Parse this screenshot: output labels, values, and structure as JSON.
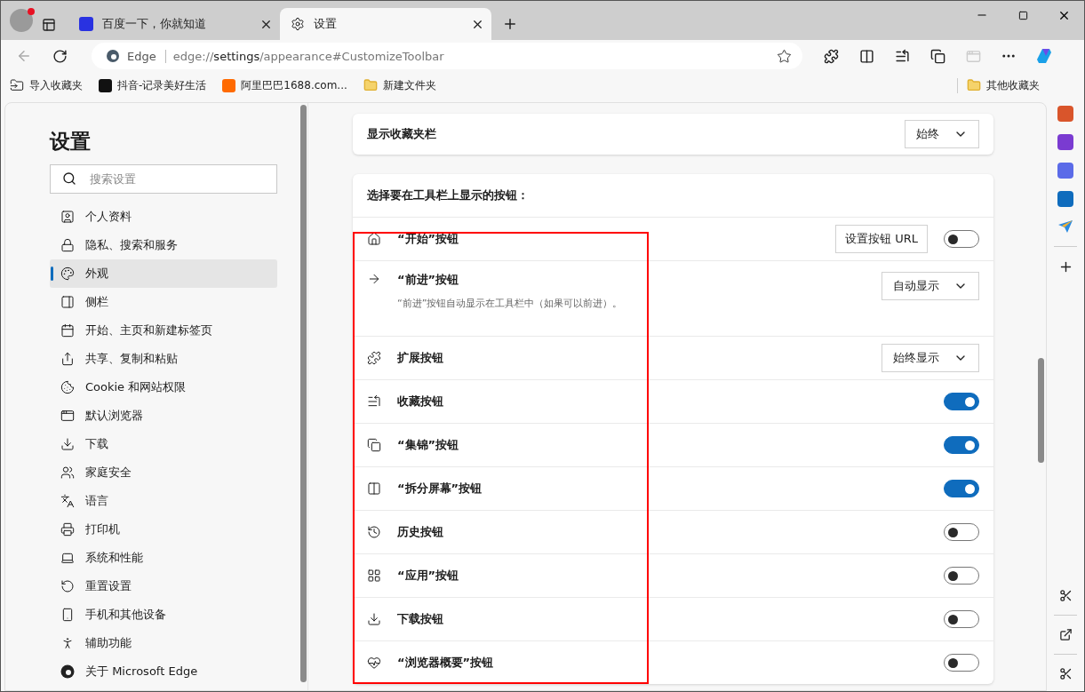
{
  "tabs": [
    {
      "title": "百度一下，你就知道",
      "selected": false
    },
    {
      "title": "设置",
      "selected": true
    }
  ],
  "address": {
    "site": "Edge",
    "url_prefix": "edge://",
    "url_host": "settings",
    "url_path": "/appearance#CustomizeToolbar"
  },
  "bookmarks": [
    {
      "label": "导入收藏夹"
    },
    {
      "label": "抖音-记录美好生活"
    },
    {
      "label": "阿里巴巴1688.com..."
    },
    {
      "label": "新建文件夹"
    }
  ],
  "other_bookmarks": "其他收藏夹",
  "settings_nav": {
    "title": "设置",
    "search_placeholder": "搜索设置",
    "items": [
      {
        "label": "个人资料",
        "selected": false
      },
      {
        "label": "隐私、搜索和服务",
        "selected": false
      },
      {
        "label": "外观",
        "selected": true
      },
      {
        "label": "侧栏",
        "selected": false
      },
      {
        "label": "开始、主页和新建标签页",
        "selected": false
      },
      {
        "label": "共享、复制和粘贴",
        "selected": false
      },
      {
        "label": "Cookie 和网站权限",
        "selected": false
      },
      {
        "label": "默认浏览器",
        "selected": false
      },
      {
        "label": "下载",
        "selected": false
      },
      {
        "label": "家庭安全",
        "selected": false
      },
      {
        "label": "语言",
        "selected": false
      },
      {
        "label": "打印机",
        "selected": false
      },
      {
        "label": "系统和性能",
        "selected": false
      },
      {
        "label": "重置设置",
        "selected": false
      },
      {
        "label": "手机和其他设备",
        "selected": false
      },
      {
        "label": "辅助功能",
        "selected": false
      },
      {
        "label": "关于 Microsoft Edge",
        "selected": false
      }
    ]
  },
  "favorites_bar": {
    "label": "显示收藏夹栏",
    "value": "始终"
  },
  "toolbar_section": {
    "heading": "选择要在工具栏上显示的按钮：",
    "rows": [
      {
        "kind": "url-toggle",
        "label": "“开始”按钮",
        "button": "设置按钮 URL",
        "on": false
      },
      {
        "kind": "select",
        "label": "“前进”按钮",
        "description": "“前进”按钮自动显示在工具栏中（如果可以前进）。",
        "value": "自动显示"
      },
      {
        "kind": "select",
        "label": "扩展按钮",
        "value": "始终显示"
      },
      {
        "kind": "toggle",
        "label": "收藏按钮",
        "on": true
      },
      {
        "kind": "toggle",
        "label": "“集锦”按钮",
        "on": true
      },
      {
        "kind": "toggle",
        "label": "“拆分屏幕”按钮",
        "on": true
      },
      {
        "kind": "toggle",
        "label": "历史按钮",
        "on": false
      },
      {
        "kind": "toggle",
        "label": "“应用”按钮",
        "on": false
      },
      {
        "kind": "toggle",
        "label": "下载按钮",
        "on": false
      },
      {
        "kind": "toggle",
        "label": "“浏览器概要”按钮",
        "on": false
      }
    ]
  }
}
